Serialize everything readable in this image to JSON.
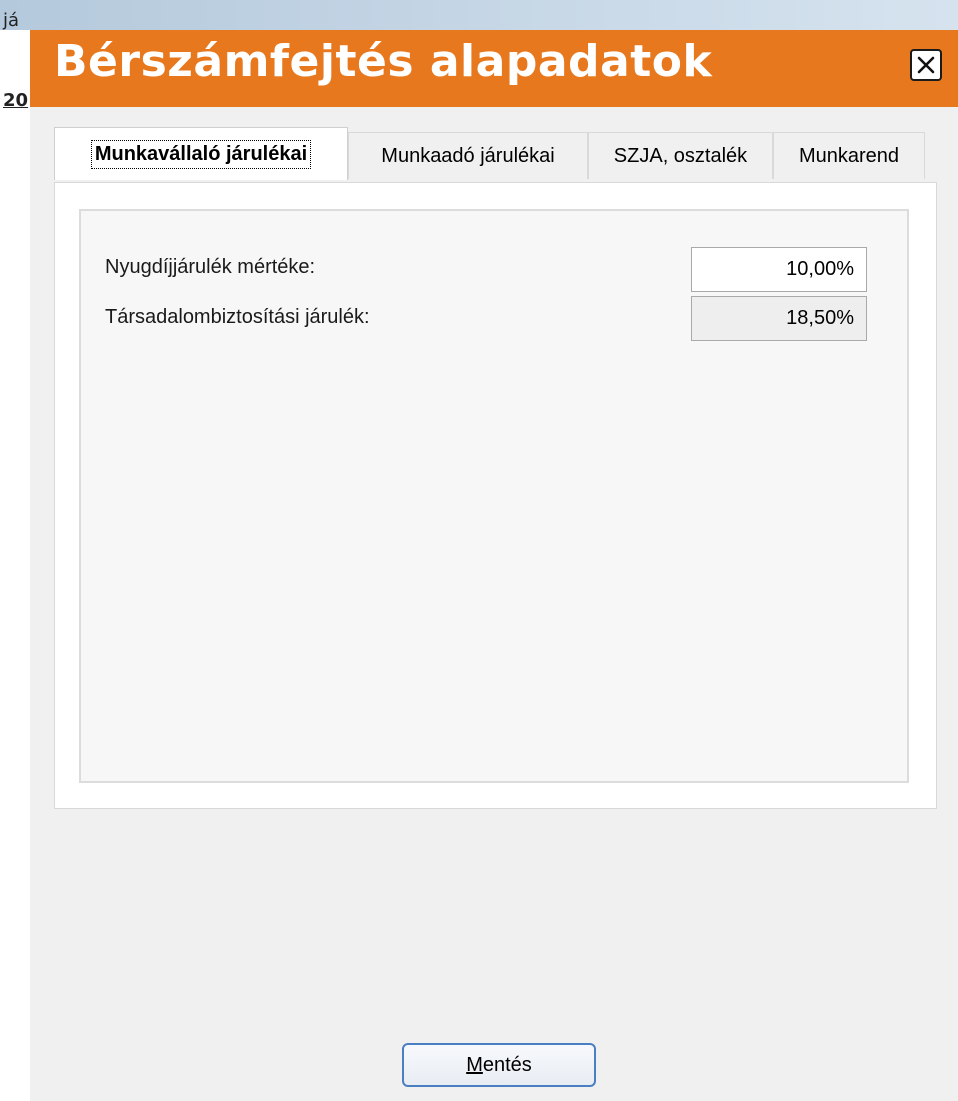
{
  "background": {
    "text_line_1": "já",
    "text_line_2": "20"
  },
  "dialog": {
    "title": "Bérszámfejtés alapadatok",
    "close_icon": "close-icon",
    "accent_color": "#e8781d"
  },
  "tabs": [
    {
      "label": "Munkavállaló járulékai",
      "active": true
    },
    {
      "label": "Munkaadó járulékai",
      "active": false
    },
    {
      "label": "SZJA, osztalék",
      "active": false
    },
    {
      "label": "Munkarend",
      "active": false
    }
  ],
  "fields": [
    {
      "label": "Nyugdíjjárulék mértéke:",
      "value": "10,00%",
      "editable": true
    },
    {
      "label": "Társadalombiztosítási járulék:",
      "value": "18,50%",
      "editable": false
    }
  ],
  "save_button": {
    "mnemonic": "M",
    "rest": "entés"
  }
}
